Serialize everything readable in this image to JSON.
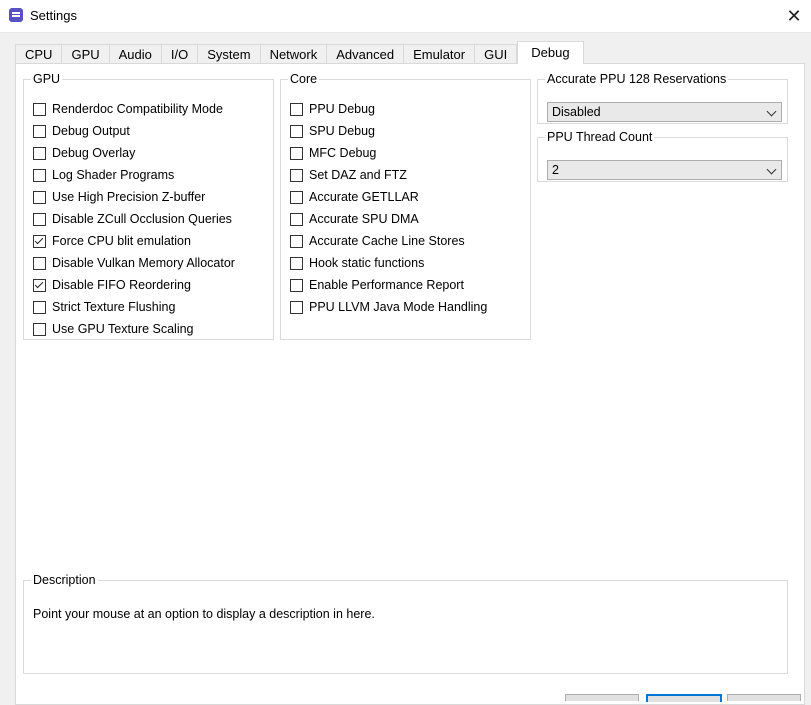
{
  "window": {
    "title": "Settings"
  },
  "tabs": [
    "CPU",
    "GPU",
    "Audio",
    "I/O",
    "System",
    "Network",
    "Advanced",
    "Emulator",
    "GUI",
    "Debug"
  ],
  "active_tab": "Debug",
  "gpu_group": {
    "title": "GPU",
    "options": [
      {
        "label": "Renderdoc Compatibility Mode",
        "checked": false
      },
      {
        "label": "Debug Output",
        "checked": false
      },
      {
        "label": "Debug Overlay",
        "checked": false
      },
      {
        "label": "Log Shader Programs",
        "checked": false
      },
      {
        "label": "Use High Precision Z-buffer",
        "checked": false
      },
      {
        "label": "Disable ZCull Occlusion Queries",
        "checked": false
      },
      {
        "label": "Force CPU blit emulation",
        "checked": true
      },
      {
        "label": "Disable Vulkan Memory Allocator",
        "checked": false
      },
      {
        "label": "Disable FIFO Reordering",
        "checked": true
      },
      {
        "label": "Strict Texture Flushing",
        "checked": false
      },
      {
        "label": "Use GPU Texture Scaling",
        "checked": false
      }
    ]
  },
  "core_group": {
    "title": "Core",
    "options": [
      {
        "label": "PPU Debug",
        "checked": false
      },
      {
        "label": "SPU Debug",
        "checked": false
      },
      {
        "label": "MFC Debug",
        "checked": false
      },
      {
        "label": "Set DAZ and FTZ",
        "checked": false
      },
      {
        "label": "Accurate GETLLAR",
        "checked": false
      },
      {
        "label": "Accurate SPU DMA",
        "checked": false
      },
      {
        "label": "Accurate Cache Line Stores",
        "checked": false
      },
      {
        "label": "Hook static functions",
        "checked": false
      },
      {
        "label": "Enable Performance Report",
        "checked": false
      },
      {
        "label": "PPU LLVM Java Mode Handling",
        "checked": false
      }
    ]
  },
  "reservations_group": {
    "title": "Accurate PPU 128 Reservations",
    "selected": "Disabled"
  },
  "thread_group": {
    "title": "PPU Thread Count",
    "selected": "2"
  },
  "description": {
    "title": "Description",
    "text": "Point your mouse at an option to display a description in here."
  }
}
